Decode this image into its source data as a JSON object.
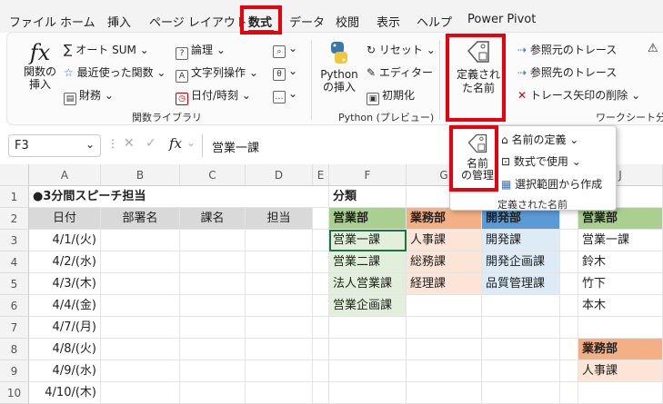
{
  "menu": [
    "ファイル",
    "ホーム",
    "挿入",
    "ページ レイアウト",
    "数式",
    "データ",
    "校閲",
    "表示",
    "ヘルプ",
    "Power Pivot"
  ],
  "ribbon": {
    "func_insert": "関数の\n挿入",
    "autosum": "オート SUM",
    "recent": "最近使った関数",
    "finance": "財務",
    "logic": "論理",
    "text": "文字列操作",
    "datetime": "日付/時刻",
    "group_lib": "関数ライブラリ",
    "python_insert": "Python\nの挿入",
    "reset": "リセット",
    "editor": "エディター",
    "init": "初期化",
    "group_python": "Python (プレビュー)",
    "defined_names": "定義され\nた名前",
    "trace_prec": "参照元のトレース",
    "trace_dep": "参照先のトレース",
    "remove_arrows": "トレース矢印の削除",
    "group_audit": "ワークシート分析"
  },
  "popup": {
    "name_manager": "名前\nの管理",
    "define": "名前の定義",
    "use": "数式で使用",
    "create": "選択範囲から作成",
    "group": "定義された名前"
  },
  "formula": {
    "cell": "F3",
    "value": "営業一課",
    "fx": "fx"
  },
  "columns": [
    "A",
    "B",
    "C",
    "D",
    "E",
    "F",
    "G",
    "H",
    "I",
    "J"
  ],
  "rows": [
    "1",
    "2",
    "3",
    "4",
    "5",
    "6",
    "7",
    "8",
    "9",
    "10"
  ],
  "sheet": {
    "title": "●3分間スピーチ担当",
    "headers": [
      "日付",
      "部署名",
      "課名",
      "担当"
    ],
    "dates": [
      "4/1/(火)",
      "4/2/(水)",
      "4/3/(木)",
      "4/4/(金)",
      "4/7/(月)",
      "4/8/(火)",
      "4/9/(水)",
      "4/10/(木)"
    ],
    "bunrui": "分類",
    "depts": [
      "営業部",
      "業務部",
      "開発部"
    ],
    "eigyo": [
      "営業一課",
      "営業二課",
      "法人営業課",
      "営業企画課"
    ],
    "gyomu": [
      "人事課",
      "総務課",
      "経理課"
    ],
    "kaihatsu": [
      "開発課",
      "開発企画課",
      "品質管理課"
    ],
    "j_head1": "営業部",
    "j_list1": [
      "営業一課",
      "鈴木",
      "竹下",
      "本木"
    ],
    "j_head2": "業務部",
    "j_list2": [
      "人事課"
    ]
  }
}
